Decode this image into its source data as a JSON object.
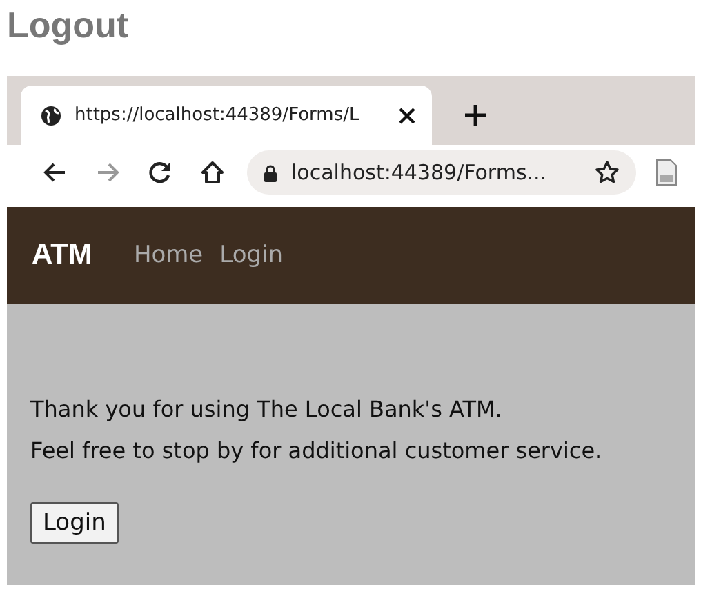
{
  "heading": "Logout",
  "browser": {
    "tab": {
      "title": "https://localhost:44389/Forms/L"
    },
    "nav_buttons": [
      {
        "kind": "back",
        "disabled": false
      },
      {
        "kind": "forward",
        "disabled": true
      },
      {
        "kind": "reload",
        "disabled": false
      },
      {
        "kind": "home",
        "disabled": false
      }
    ],
    "address": "localhost:44389/Forms..."
  },
  "navbar": {
    "brand": "ATM",
    "links": [
      {
        "label": "Home"
      },
      {
        "label": "Login"
      }
    ]
  },
  "message": [
    "Thank you for using The Local Bank's ATM.",
    "Feel free to stop by for additional customer service."
  ],
  "button": "Login"
}
